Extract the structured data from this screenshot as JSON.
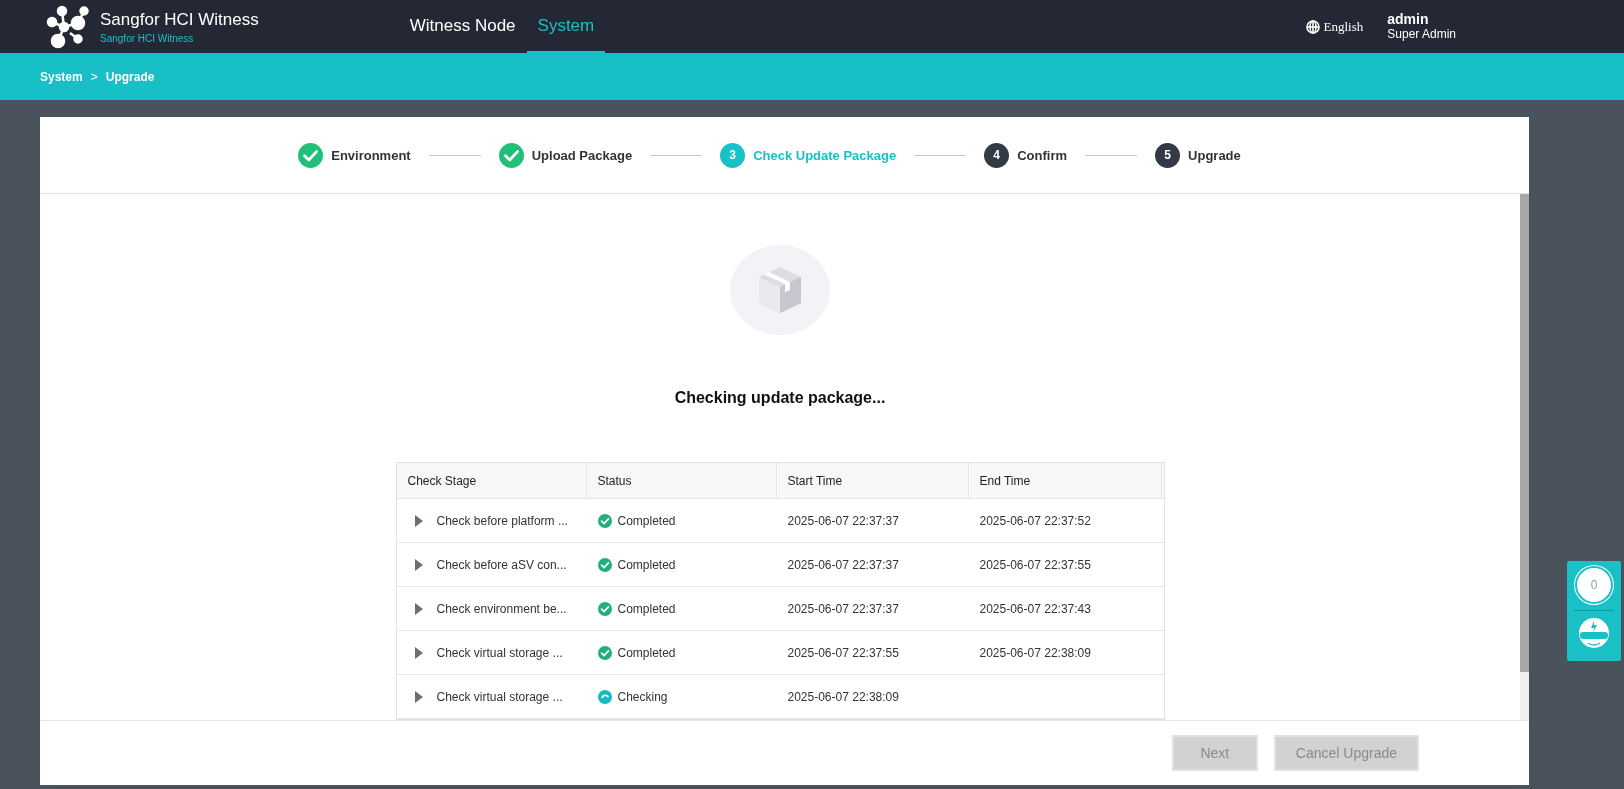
{
  "header": {
    "product": "Sangfor HCI Witness",
    "product_sub": "Sangfor HCI Witness",
    "nav": [
      {
        "label": "Witness Node",
        "selected": false
      },
      {
        "label": "System",
        "selected": true
      }
    ],
    "language": "English",
    "user": "admin",
    "role": "Super Admin"
  },
  "breadcrumb": [
    "System",
    ">",
    "Upgrade"
  ],
  "steps": [
    {
      "label": "Environment",
      "kind": "done"
    },
    {
      "label": "Upload Package",
      "kind": "done"
    },
    {
      "label": "Check Update Package",
      "number": "3",
      "kind": "active"
    },
    {
      "label": "Confirm",
      "number": "4",
      "kind": "pending"
    },
    {
      "label": "Upgrade",
      "number": "5",
      "kind": "pending"
    }
  ],
  "message": "Checking update package...",
  "table": {
    "columns": [
      "Check Stage",
      "Status",
      "Start Time",
      "End Time"
    ],
    "rows": [
      {
        "stage": "Check before platform ...",
        "kind": "completed",
        "status": "Completed",
        "start": "2025-06-07 22:37:37",
        "end": "2025-06-07 22:37:52"
      },
      {
        "stage": "Check before aSV con...",
        "kind": "completed",
        "status": "Completed",
        "start": "2025-06-07 22:37:37",
        "end": "2025-06-07 22:37:55"
      },
      {
        "stage": "Check environment be...",
        "kind": "completed",
        "status": "Completed",
        "start": "2025-06-07 22:37:37",
        "end": "2025-06-07 22:37:43"
      },
      {
        "stage": "Check virtual storage ...",
        "kind": "completed",
        "status": "Completed",
        "start": "2025-06-07 22:37:55",
        "end": "2025-06-07 22:38:09"
      },
      {
        "stage": "Check virtual storage ...",
        "kind": "checking",
        "status": "Checking",
        "start": "2025-06-07 22:38:09"
      }
    ]
  },
  "buttons": [
    {
      "label": "Next",
      "disabled": true
    },
    {
      "label": "Cancel Upgrade",
      "disabled": true
    }
  ],
  "widget": {
    "count": "0"
  }
}
